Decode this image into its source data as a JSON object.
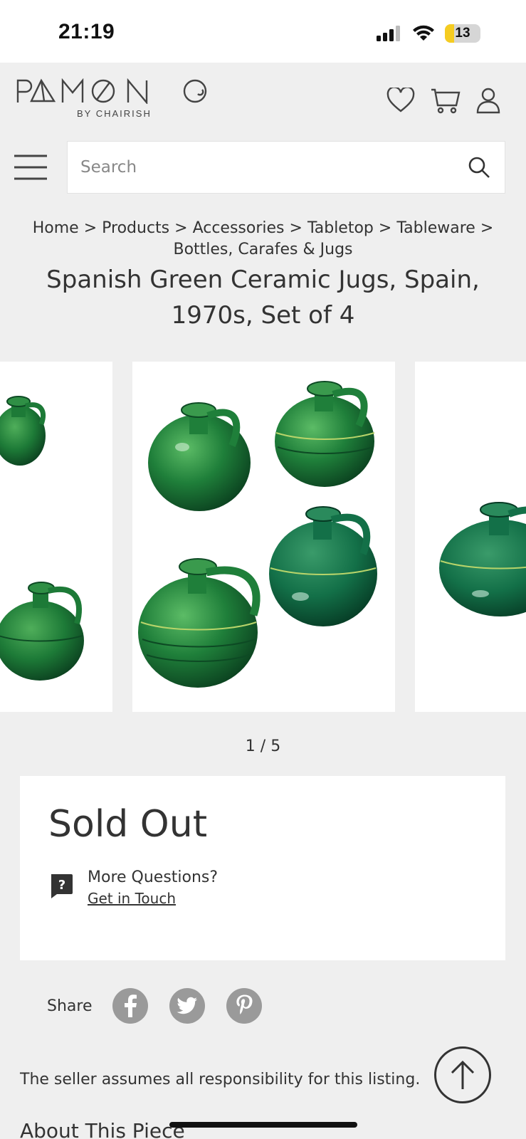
{
  "status_bar": {
    "time": "21:19",
    "battery": "13"
  },
  "brand": {
    "logo_word": "PAMONO",
    "byline": "BY CHAIRISH"
  },
  "search": {
    "placeholder": "Search"
  },
  "breadcrumb": {
    "items": [
      "Home",
      "Products",
      "Accessories",
      "Tabletop",
      "Tableware",
      "Bottles, Carafes & Jugs"
    ],
    "separator": ">"
  },
  "product": {
    "title": "Spanish Green Ceramic Jugs, Spain, 1970s, Set of 4"
  },
  "gallery": {
    "pager": "1 / 5"
  },
  "availability": {
    "status": "Sold Out",
    "help_question": "More Questions?",
    "help_link": "Get in Touch"
  },
  "share": {
    "label": "Share",
    "networks": [
      "facebook",
      "twitter",
      "pinterest"
    ]
  },
  "disclaimer": "The seller assumes all responsibility for this listing.",
  "about_heading": "About This Piece",
  "colors": {
    "background": "#efefef",
    "text": "#333333",
    "jug_green": "#1f7a3a",
    "social_gray": "#9a9a9a"
  }
}
